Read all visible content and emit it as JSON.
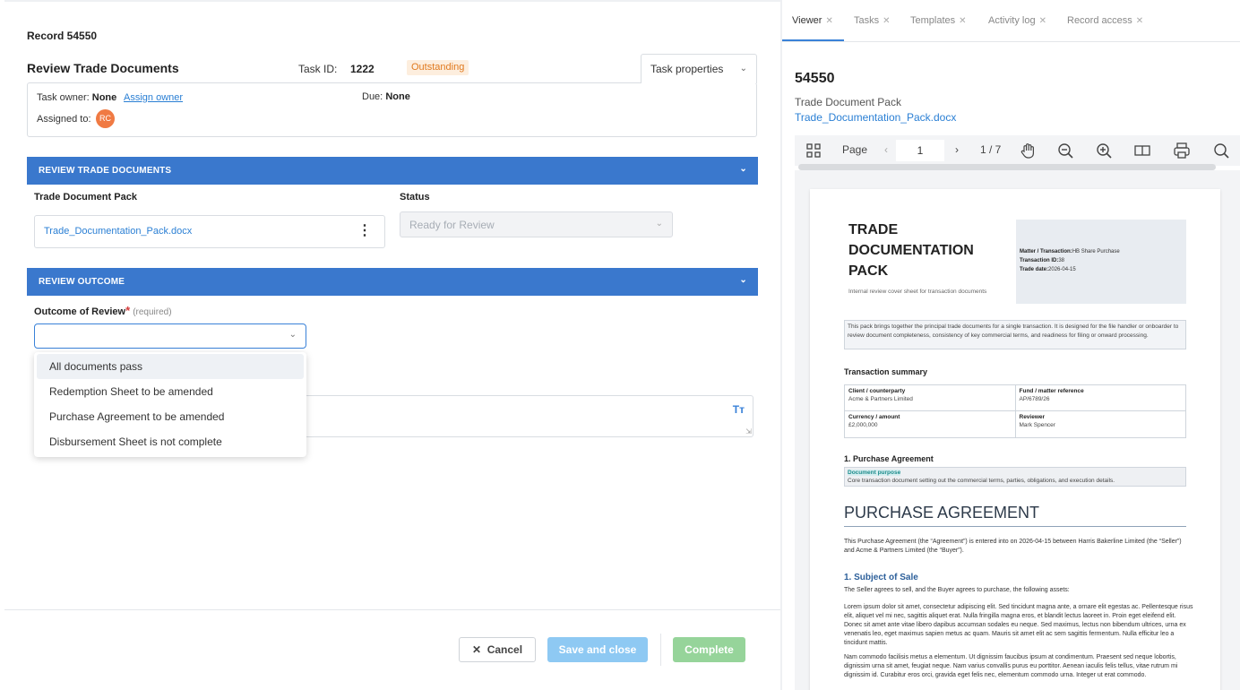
{
  "left": {
    "record_title": "Record 54550",
    "task_title": "Review Trade Documents",
    "task_id_label": "Task ID:",
    "task_id_value": "1222",
    "status_badge": "Outstanding",
    "task_properties": "Task properties",
    "task_owner_label": "Task owner:",
    "task_owner_value": "None",
    "assign_owner": "Assign owner",
    "due_label": "Due:",
    "due_value": "None",
    "assigned_to_label": "Assigned to:",
    "assignee_initials": "RC",
    "section1_title": "REVIEW TRADE DOCUMENTS",
    "doc_pack_label": "Trade Document Pack",
    "doc_pack_file": "Trade_Documentation_Pack.docx",
    "status_label": "Status",
    "status_value": "Ready for Review",
    "section2_title": "REVIEW OUTCOME",
    "outcome_label": "Outcome of Review",
    "outcome_required": "(required)",
    "outcome_options": [
      "All documents pass",
      "Redemption Sheet to be amended",
      "Purchase Agreement to be amended",
      "Disbursement Sheet is not complete"
    ],
    "cancel": "Cancel",
    "save_close": "Save and close",
    "complete": "Complete"
  },
  "right": {
    "tabs": [
      {
        "label": "Viewer",
        "active": true
      },
      {
        "label": "Tasks",
        "active": false
      },
      {
        "label": "Templates",
        "active": false
      },
      {
        "label": "Activity log",
        "active": false
      },
      {
        "label": "Record access",
        "active": false
      }
    ],
    "record_number": "54550",
    "record_subtitle": "Trade Document Pack",
    "record_file": "Trade_Documentation_Pack.docx",
    "toolbar": {
      "page_label": "Page",
      "page_value": "1",
      "page_count": "1 / 7",
      "icons": [
        "grid-icon",
        "hand-icon",
        "zoom-out-icon",
        "zoom-in-icon",
        "columns-icon",
        "print-icon",
        "search-icon"
      ]
    }
  },
  "document": {
    "title": "TRADE DOCUMENTATION PACK",
    "title_line1": "TRADE",
    "title_line2": "DOCUMENTATION",
    "title_line3": "PACK",
    "cover_note": "Internal review cover sheet for transaction documents",
    "meta_matter_label": "Matter / Transaction:",
    "meta_matter_value": "HB Share Purchase",
    "meta_txn_label": "Transaction ID:",
    "meta_txn_value": "38",
    "meta_date_label": "Trade date:",
    "meta_date_value": "2026-04-15",
    "intro": "This pack brings together the principal trade documents for a single transaction. It is designed for the file handler or onboarder to review document completeness, consistency of key commercial terms, and readiness for filing or onward processing.",
    "summary_heading": "Transaction summary",
    "client_label": "Client / counterparty",
    "client_value": "Acme & Partners Limited",
    "fund_label": "Fund / matter reference",
    "fund_value": "AP/6789/26",
    "currency_label": "Currency / amount",
    "currency_value": "£2,000,000",
    "reviewer_label": "Reviewer",
    "reviewer_value": "Mark Spencer",
    "pa_heading": "1. Purchase Agreement",
    "purpose_label": "Document purpose",
    "purpose_text": "Core transaction document setting out the commercial terms, parties, obligations, and execution details.",
    "big_heading": "PURCHASE AGREEMENT",
    "agreement_para": "This Purchase Agreement (the “Agreement”) is entered into on 2026-04-15 between Harris Bakerline Limited (the “Seller”) and Acme & Partners Limited (the “Buyer”).",
    "subject_heading": "1. Subject of Sale",
    "subject_para": "The Seller agrees to sell, and the Buyer agrees to purchase, the following assets:",
    "lorem1": "Lorem ipsum dolor sit amet, consectetur adipiscing elit. Sed tincidunt magna ante, a ornare elit egestas ac. Pellentesque risus elit, aliquet vel mi nec, sagittis aliquet erat. Nulla fringilla magna eros, et blandit lectus laoreet in. Proin eget eleifend elit. Donec sit amet ante vitae libero dapibus accumsan sodales eu neque. Sed maximus, lectus non bibendum ultrices, urna ex venenatis leo, eget maximus sapien metus ac quam. Mauris sit amet elit ac sem sagittis fermentum. Nulla efficitur leo a tincidunt mattis.",
    "lorem2": "Nam commodo facilisis metus a elementum. Ut dignissim faucibus ipsum at condimentum. Praesent sed neque lobortis, dignissim urna sit amet, feugiat neque. Nam varius convallis purus eu porttitor. Aenean iaculis felis tellus, vitae rutrum mi dignissim id. Curabitur eros orci, gravida eget felis nec, elementum commodo urna. Integer ut erat commodo."
  }
}
